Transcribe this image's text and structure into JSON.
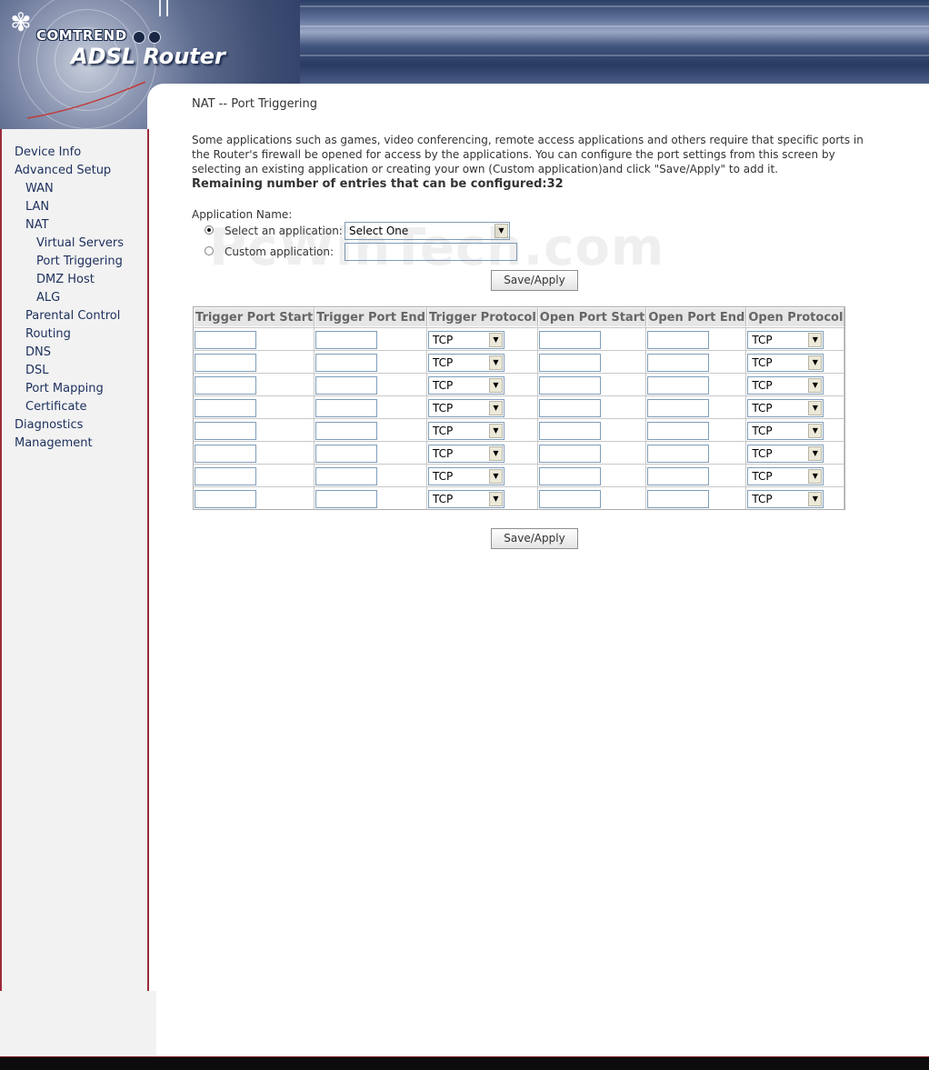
{
  "header": {
    "brand": "COMTREND",
    "product": "ADSL Router"
  },
  "sidebar": {
    "items": [
      {
        "label": "Device Info",
        "level": 1
      },
      {
        "label": "Advanced Setup",
        "level": 1
      },
      {
        "label": "WAN",
        "level": 2
      },
      {
        "label": "LAN",
        "level": 2
      },
      {
        "label": "NAT",
        "level": 2
      },
      {
        "label": "Virtual Servers",
        "level": 3
      },
      {
        "label": "Port Triggering",
        "level": 3
      },
      {
        "label": "DMZ Host",
        "level": 3
      },
      {
        "label": "ALG",
        "level": 3
      },
      {
        "label": "Parental Control",
        "level": 2
      },
      {
        "label": "Routing",
        "level": 2
      },
      {
        "label": "DNS",
        "level": 2
      },
      {
        "label": "DSL",
        "level": 2
      },
      {
        "label": "Port Mapping",
        "level": 2
      },
      {
        "label": "Certificate",
        "level": 2
      },
      {
        "label": "Diagnostics",
        "level": 1
      },
      {
        "label": "Management",
        "level": 1
      }
    ]
  },
  "main": {
    "title": "NAT -- Port Triggering",
    "description": "Some applications such as games, video conferencing, remote access applications and others require that specific ports in the Router's firewall be opened for access by the applications. You can configure the port settings from this screen by selecting an existing application or creating your own (Custom application)and click \"Save/Apply\" to add it.",
    "remaining": "Remaining number of entries that can be configured:32",
    "app_name_label": "Application Name:",
    "select_app_label": "Select an application:",
    "select_app_value": "Select One",
    "custom_app_label": "Custom application:",
    "custom_app_value": "",
    "save_label": "Save/Apply",
    "save_label_bottom": "Save/Apply"
  },
  "table": {
    "headers": [
      "Trigger Port Start",
      "Trigger Port End",
      "Trigger Protocol",
      "Open Port Start",
      "Open Port End",
      "Open Protocol"
    ],
    "rows": [
      {
        "trigger_start": "",
        "trigger_end": "",
        "trigger_protocol": "TCP",
        "open_start": "",
        "open_end": "",
        "open_protocol": "TCP"
      },
      {
        "trigger_start": "",
        "trigger_end": "",
        "trigger_protocol": "TCP",
        "open_start": "",
        "open_end": "",
        "open_protocol": "TCP"
      },
      {
        "trigger_start": "",
        "trigger_end": "",
        "trigger_protocol": "TCP",
        "open_start": "",
        "open_end": "",
        "open_protocol": "TCP"
      },
      {
        "trigger_start": "",
        "trigger_end": "",
        "trigger_protocol": "TCP",
        "open_start": "",
        "open_end": "",
        "open_protocol": "TCP"
      },
      {
        "trigger_start": "",
        "trigger_end": "",
        "trigger_protocol": "TCP",
        "open_start": "",
        "open_end": "",
        "open_protocol": "TCP"
      },
      {
        "trigger_start": "",
        "trigger_end": "",
        "trigger_protocol": "TCP",
        "open_start": "",
        "open_end": "",
        "open_protocol": "TCP"
      },
      {
        "trigger_start": "",
        "trigger_end": "",
        "trigger_protocol": "TCP",
        "open_start": "",
        "open_end": "",
        "open_protocol": "TCP"
      },
      {
        "trigger_start": "",
        "trigger_end": "",
        "trigger_protocol": "TCP",
        "open_start": "",
        "open_end": "",
        "open_protocol": "TCP"
      }
    ]
  },
  "watermark": "PcWinTech.com",
  "colors": {
    "sidebar_border": "#9c2a3a",
    "nav_text": "#1c2f5c",
    "header_bg": "#2c3f66"
  },
  "icons": {
    "logo": "comtrend-flower-icon",
    "dropdown": "chevron-down-icon"
  }
}
